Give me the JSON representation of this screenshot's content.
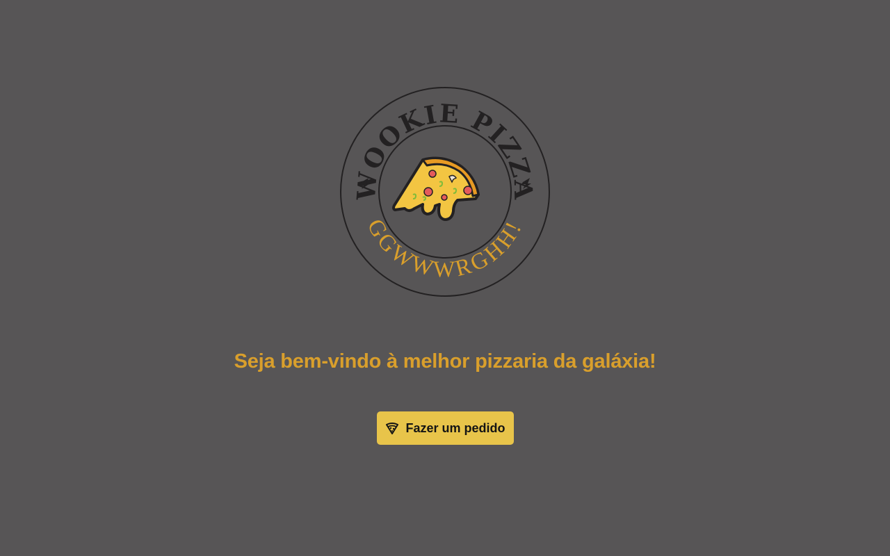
{
  "logo": {
    "top_text": "WOOKIE PIZZA",
    "bottom_text": "GGWWWRGHH!",
    "center_icon": "pizza-slice-icon",
    "side_icons": "lightning-bolt-icon"
  },
  "main": {
    "headline": "Seja bem-vindo à melhor pizzaria da galáxia!",
    "order_button": {
      "label": "Fazer um pedido",
      "icon": "pizza-icon"
    }
  },
  "colors": {
    "background": "#575556",
    "accent": "#d99f2c",
    "button": "#e8c44a",
    "dark": "#232122"
  }
}
